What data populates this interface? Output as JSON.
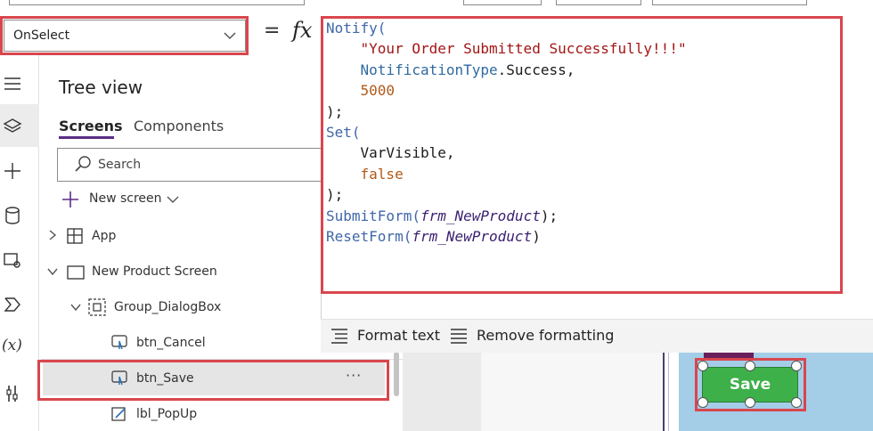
{
  "formula_bar": {
    "property_value": "OnSelect",
    "equals_sign": "=",
    "fx_label": "fx"
  },
  "tree": {
    "title": "Tree view",
    "tabs": [
      {
        "label": "Screens"
      },
      {
        "label": "Components"
      }
    ],
    "search_placeholder": "Search",
    "new_screen_label": "New screen",
    "items": [
      {
        "label": "App"
      },
      {
        "label": "New Product Screen"
      },
      {
        "label": "Group_DialogBox"
      },
      {
        "label": "btn_Cancel"
      },
      {
        "label": "btn_Save"
      },
      {
        "label": "lbl_PopUp"
      }
    ],
    "more_options": "···"
  },
  "code": {
    "notify_fn": "Notify(",
    "message": "\"Your Order Submitted Successfully!!!\"",
    "notification_enum": "NotificationType",
    "notification_member": ".Success,",
    "timeout": "5000",
    "close_paren": ");",
    "set_fn": "Set(",
    "var_name": "VarVisible,",
    "var_value": "false",
    "submit_fn": "SubmitForm(",
    "submit_arg": "frm_NewProduct",
    "submit_close": ");",
    "reset_fn": "ResetForm(",
    "reset_arg": "frm_NewProduct",
    "reset_close": ")"
  },
  "format_bar": {
    "format_text": "Format text",
    "remove_formatting": "Remove formatting"
  },
  "canvas": {
    "save_button_label": "Save"
  },
  "colors": {
    "accent": "#5b2d86",
    "highlight_border": "#d9464d",
    "save_button": "#3db049",
    "canvas_blue": "#a4cde8"
  }
}
